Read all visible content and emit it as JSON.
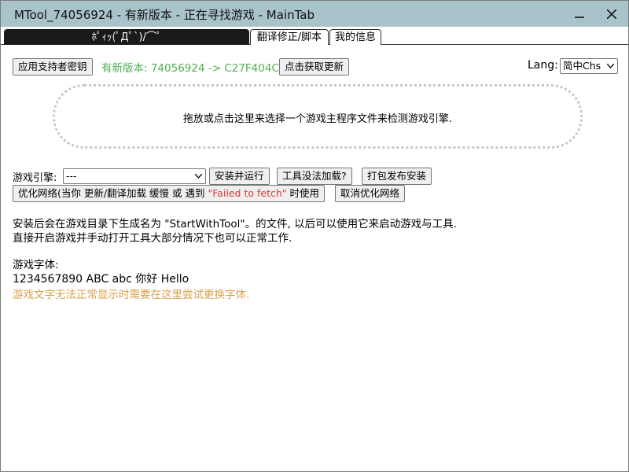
{
  "window": {
    "title": "MTool_74056924 - 有新版本 - 正在寻找游戏 - MainTab",
    "minimize_icon": "minimize-icon",
    "close_icon": "close-icon"
  },
  "tabs": [
    {
      "label": "ﾎﾟｨｯ(ﾟДﾟ`)/⌒ﾟ",
      "active": true
    },
    {
      "label": "翻译修正/脚本",
      "active": false
    },
    {
      "label": "我的信息",
      "active": false
    }
  ],
  "toolbar": {
    "supporter_key_button": "应用支持者密钥",
    "version_text": "有新版本: 74056924 -> C27F404C",
    "update_button": "点击获取更新",
    "lang_label": "Lang:",
    "lang_value": "简中Chs"
  },
  "dropzone": {
    "text": "拖放或点击这里来选择一个游戏主程序文件来检测游戏引擎."
  },
  "engine": {
    "label": "游戏引擎:",
    "selected": "---",
    "install_run_button": "安装并运行",
    "tool_not_loaded_button": "工具没法加载?",
    "package_button": "打包发布安装"
  },
  "network": {
    "optimize_prefix": "优化网络(当你 更新/翻译加载 缓慢 或 遇到 ",
    "optimize_error": "\"Failed to fetch\"",
    "optimize_suffix": " 时使用",
    "cancel_button": "取消优化网络"
  },
  "info": {
    "line1": "安装后会在游戏目录下生成名为 \"StartWithTool\"。的文件, 以后可以使用它来启动游戏与工具.",
    "line2": "直接开启游戏并手动打开工具大部分情况下也可以正常工作."
  },
  "font": {
    "label": "游戏字体:",
    "sample": "1234567890 ABC abc 你好 Hello",
    "hint": "游戏文字无法正常显示时需要在这里尝试更换字体."
  },
  "colors": {
    "titlebar": "#a9c3cb",
    "version_green": "#4caf50",
    "error_red": "#e53935",
    "hint_orange": "#d9a24a",
    "active_tab": "#1a1a1a"
  }
}
